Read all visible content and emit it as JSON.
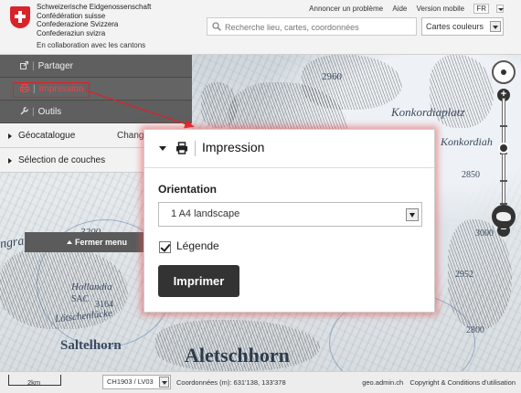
{
  "header": {
    "org_lines": [
      "Schweizerische Eidgenossenschaft",
      "Confédération suisse",
      "Confederazione Svizzera",
      "Confederaziun svizra"
    ],
    "collab": "En collaboration avec les cantons",
    "search_placeholder": "Recherche lieu, cartes, coordonnées",
    "links": {
      "report": "Annoncer un problème",
      "help": "Aide",
      "mobile": "Version mobile"
    },
    "language": "FR",
    "basemap": "Cartes couleurs"
  },
  "menu": {
    "share": "Partager",
    "print": "Impression",
    "tools": "Outils",
    "geocatalog": "Géocatalogue",
    "geocatalog_extra": "Chang",
    "layers": "Sélection de couches",
    "close": "Fermer menu"
  },
  "popup": {
    "title": "Impression",
    "orientation_label": "Orientation",
    "orientation_value": "1 A4 landscape",
    "legend_label": "Légende",
    "legend_checked": true,
    "print_button": "Imprimer"
  },
  "map": {
    "labels": {
      "konkordiaplatz": "Konkordiaplatz",
      "konkordiah": "Konkordiah",
      "aletschhorn": "Aletschhorn",
      "saltelhorn": "Saltelhorn",
      "hollandia": "Hollandia",
      "sac": "SAC",
      "lotschenlucke": "Lötschenlücke",
      "h2960": "2960",
      "h3164": "3164",
      "h3200": "3200",
      "h2952": "2952",
      "h2800": "2800",
      "h3000": "3000",
      "h2850": "2850",
      "ngrat": "ngrat"
    }
  },
  "footer": {
    "scale": "2km",
    "projection": "CH1903 / LV03",
    "coordinates": "Coordonnées (m): 631'138, 133'378",
    "site": "geo.admin.ch",
    "copyright": "Copyright & Conditions d'utilisation"
  },
  "colors": {
    "brand_red": "#d8232a",
    "menu_dark": "#5f5f5f",
    "button_dark": "#333333"
  }
}
